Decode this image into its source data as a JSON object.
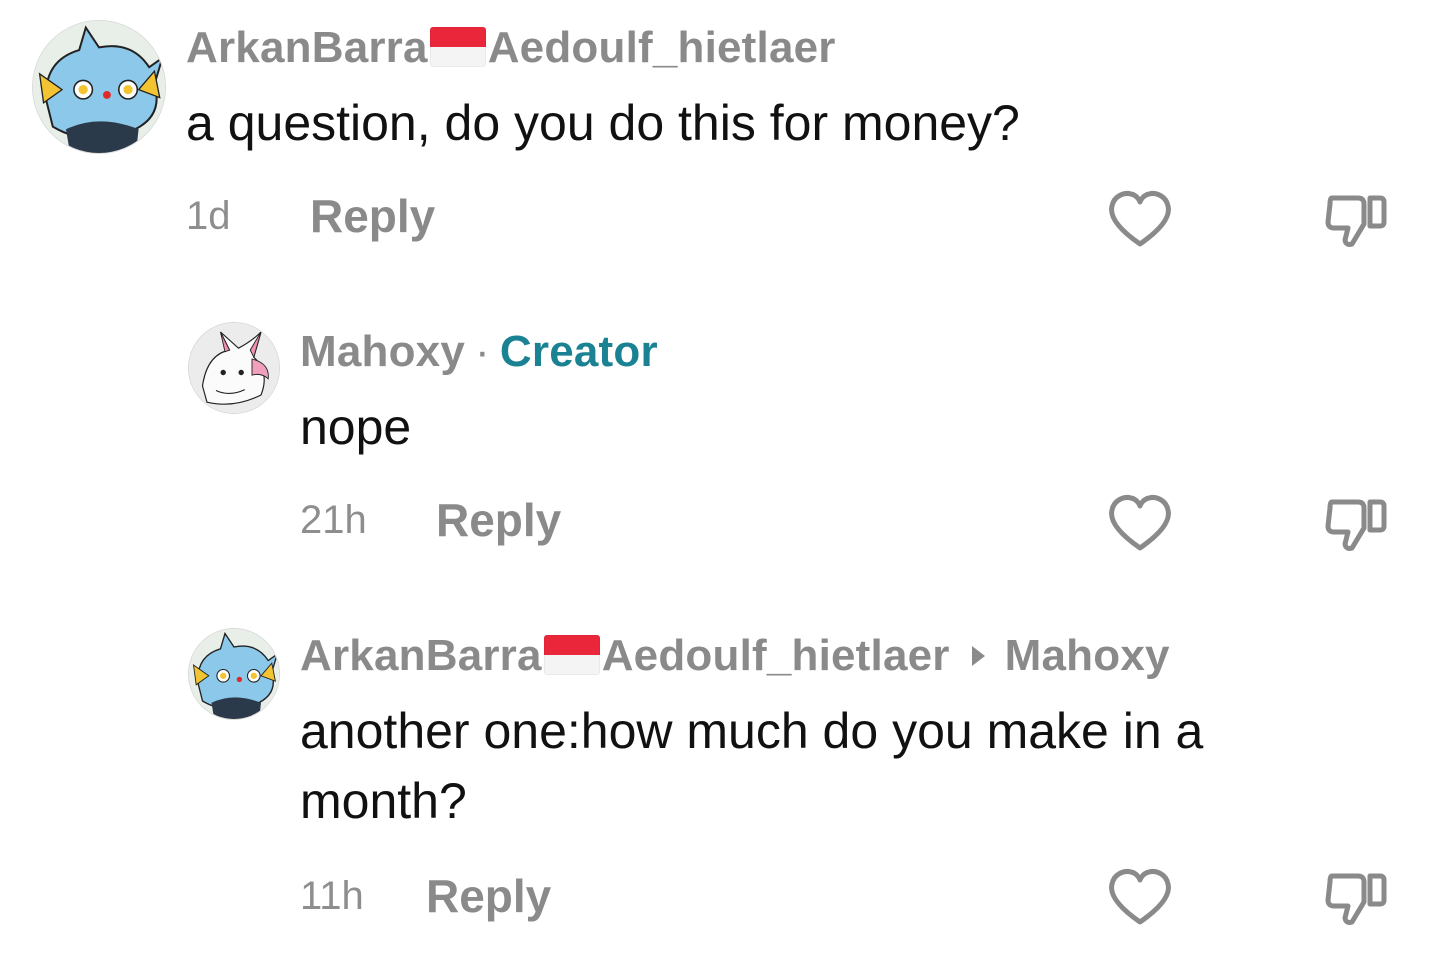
{
  "comments": [
    {
      "author_first": "ArkanBarra",
      "author_second": "Aedoulf_hietlaer",
      "flag_icon": "indonesia-flag-emoji",
      "text": "a question, do you do this for money?",
      "time": "1d",
      "reply_label": "Reply",
      "avatar_icon": "blue-creature-avatar"
    },
    {
      "author": "Mahoxy",
      "separator": "·",
      "badge": "Creator",
      "text": "nope",
      "time": "21h",
      "reply_label": "Reply",
      "avatar_icon": "pink-fox-sketch-avatar"
    },
    {
      "author_first": "ArkanBarra",
      "author_second": "Aedoulf_hietlaer",
      "flag_icon": "indonesia-flag-emoji",
      "reply_to": "Mahoxy",
      "text_line1": "another one:how much do you make in a",
      "text_line2": "month?",
      "time": "11h",
      "reply_label": "Reply",
      "avatar_icon": "blue-creature-avatar"
    }
  ],
  "icons": {
    "like": "heart-outline-icon",
    "dislike": "thumbs-down-icon"
  },
  "colors": {
    "creator_badge": "#1a8293",
    "username": "#8a8a8a",
    "flag_red": "#e9263a"
  }
}
